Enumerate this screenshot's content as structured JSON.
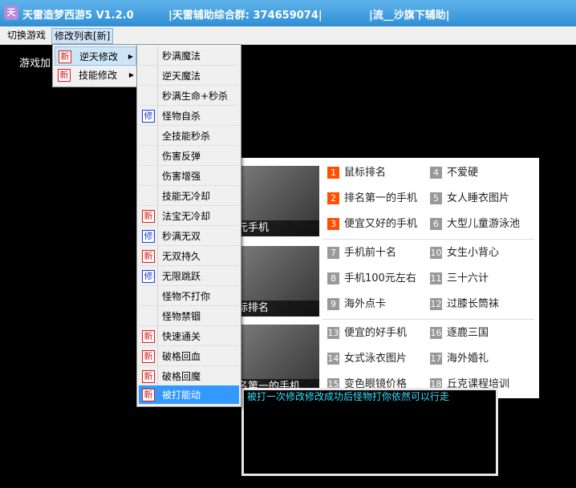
{
  "titlebar": {
    "app_icon": "tianlei-app-icon",
    "title": "天雷造梦西游5 V1.2.0",
    "group": "|天雷辅助综合群: 374659074|",
    "author": "|流__沙旗下辅助|"
  },
  "menubar": {
    "switch_game": "切换游戏",
    "mod_list": "修改列表[新]"
  },
  "game_area_text": "游戏加",
  "menu_l1": [
    {
      "badge": "新",
      "label": "逆天修改"
    },
    {
      "badge": "新",
      "label": "技能修改"
    }
  ],
  "menu_l2": [
    {
      "badge": "",
      "label": "秒满魔法"
    },
    {
      "badge": "",
      "label": "逆天魔法"
    },
    {
      "badge": "",
      "label": "秒满生命+秒杀"
    },
    {
      "badge": "修",
      "label": "怪物自杀"
    },
    {
      "badge": "",
      "label": "全技能秒杀"
    },
    {
      "badge": "",
      "label": "伤害反弹"
    },
    {
      "badge": "",
      "label": "伤害增强"
    },
    {
      "badge": "",
      "label": "技能无冷却"
    },
    {
      "badge": "新",
      "label": "法宝无冷却"
    },
    {
      "badge": "修",
      "label": "秒满无双"
    },
    {
      "badge": "新",
      "label": "无双持久"
    },
    {
      "badge": "修",
      "label": "无限跳跃"
    },
    {
      "badge": "",
      "label": "怪物不打你"
    },
    {
      "badge": "",
      "label": "怪物禁锢"
    },
    {
      "badge": "新",
      "label": "快速通关"
    },
    {
      "badge": "新",
      "label": "破格回血"
    },
    {
      "badge": "新",
      "label": "破格回魔"
    },
    {
      "badge": "新",
      "label": "被打能动"
    }
  ],
  "ad_panel": {
    "image_captions": [
      "元手机",
      "标排名",
      "名第一的手机"
    ],
    "groups": [
      {
        "left": [
          {
            "num": "1",
            "text": "鼠标排名"
          },
          {
            "num": "2",
            "text": "排名第一的手机"
          },
          {
            "num": "3",
            "text": "便宜又好的手机"
          }
        ],
        "right": [
          {
            "num": "4",
            "text": "不爱硬"
          },
          {
            "num": "5",
            "text": "女人睡衣图片"
          },
          {
            "num": "6",
            "text": "大型儿童游泳池"
          }
        ]
      },
      {
        "left": [
          {
            "num": "7",
            "text": "手机前十名"
          },
          {
            "num": "8",
            "text": "手机100元左右"
          },
          {
            "num": "9",
            "text": "海外点卡"
          }
        ],
        "right": [
          {
            "num": "10",
            "text": "女生小背心"
          },
          {
            "num": "11",
            "text": "三十六计"
          },
          {
            "num": "12",
            "text": "过膝长筒袜"
          }
        ]
      },
      {
        "left": [
          {
            "num": "13",
            "text": "便宜的好手机"
          },
          {
            "num": "14",
            "text": "女式泳衣图片"
          },
          {
            "num": "15",
            "text": "变色眼镜价格"
          }
        ],
        "right": [
          {
            "num": "16",
            "text": "逐鹿三国"
          },
          {
            "num": "17",
            "text": "海外婚礼"
          },
          {
            "num": "18",
            "text": "丘克课程培训"
          }
        ]
      }
    ]
  },
  "tooltip": {
    "message": "被打一次修改修改成功后怪物打你依然可以行走"
  },
  "colors": {
    "titlebar": "#2f8fd6",
    "rank_hot": "#ff5000",
    "rank_normal": "#999999",
    "menu_highlight": "#3399ff",
    "badge_new": "#d81b1b",
    "badge_fix": "#1b3dd8",
    "tooltip_text": "#34e0ff"
  }
}
